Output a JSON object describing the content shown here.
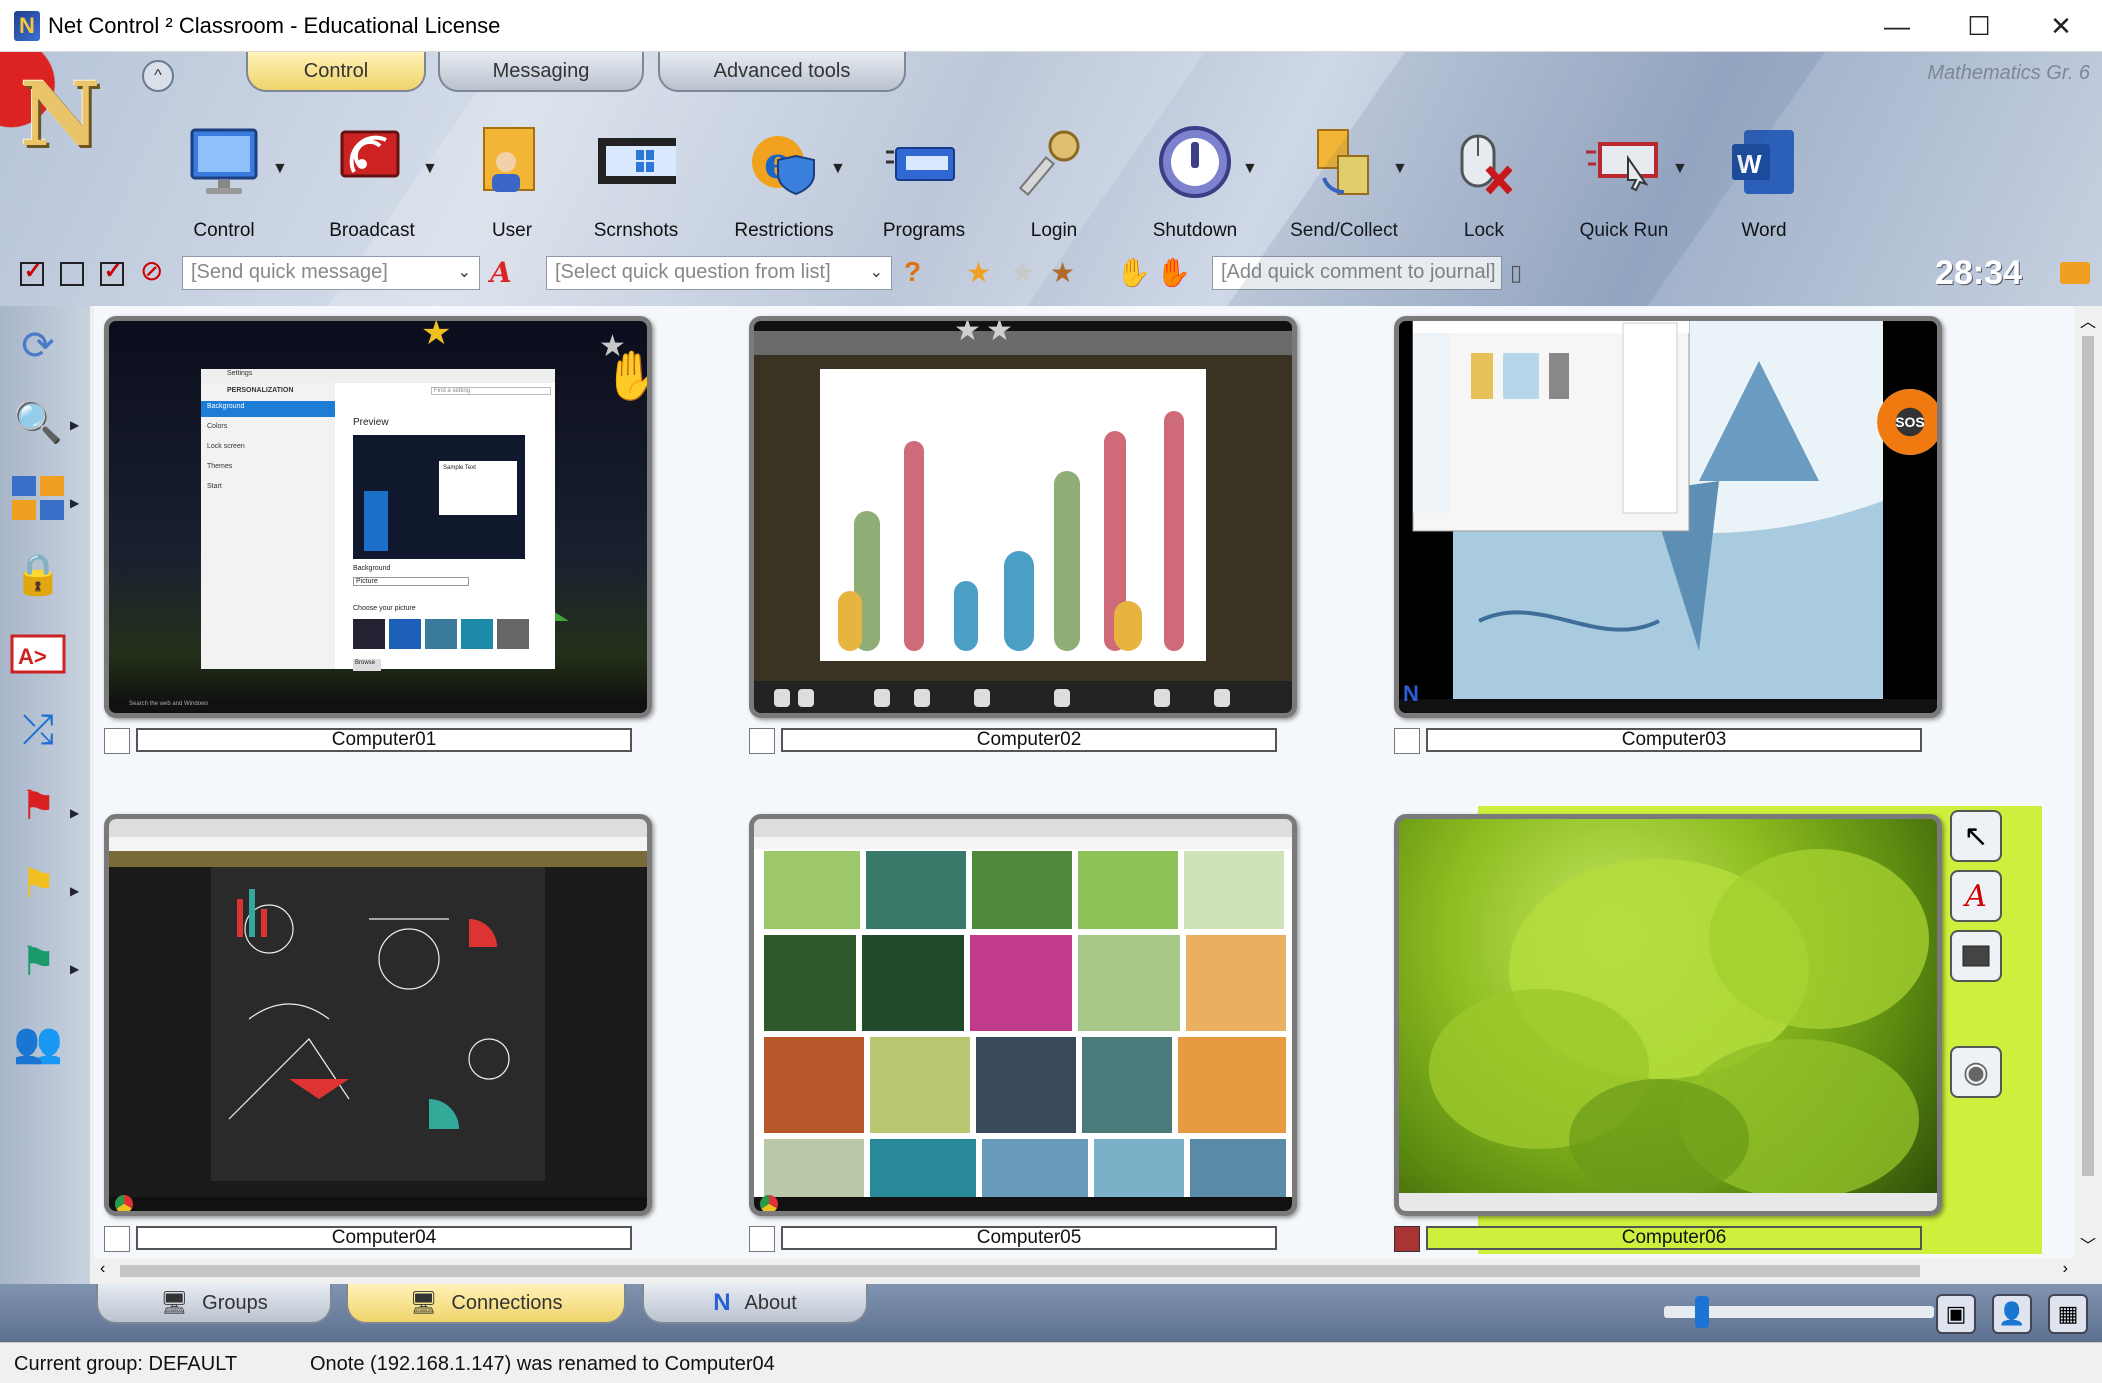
{
  "window": {
    "title": "Net Control ² Classroom - Educational License",
    "min": "—",
    "max": "☐",
    "close": "✕"
  },
  "ribbon": {
    "collapse": "^",
    "tabs": [
      "Control",
      "Messaging",
      "Advanced tools"
    ],
    "class_label": "Mathematics Gr. 6",
    "tools": [
      {
        "label": "Control",
        "icon": "monitor-icon"
      },
      {
        "label": "Broadcast",
        "icon": "broadcast-icon"
      },
      {
        "label": "User",
        "icon": "user-icon"
      },
      {
        "label": "Scrnshots",
        "icon": "film-icon"
      },
      {
        "label": "Restrictions",
        "icon": "shield-icon"
      },
      {
        "label": "Programs",
        "icon": "programs-icon"
      },
      {
        "label": "Login",
        "icon": "key-icon"
      },
      {
        "label": "Shutdown",
        "icon": "power-icon"
      },
      {
        "label": "Send/Collect",
        "icon": "files-icon"
      },
      {
        "label": "Lock",
        "icon": "mouse-lock-icon"
      },
      {
        "label": "Quick Run",
        "icon": "quick-run-icon"
      },
      {
        "label": "Word",
        "icon": "word-icon"
      }
    ],
    "quick_message_placeholder": "[Send quick message]",
    "quick_question_placeholder": "[Select quick question from list]",
    "journal_placeholder": "[Add quick comment to journal]",
    "clock": "28:34"
  },
  "computers": [
    {
      "name": "Computer01",
      "checked": false
    },
    {
      "name": "Computer02",
      "checked": false
    },
    {
      "name": "Computer03",
      "checked": false
    },
    {
      "name": "Computer04",
      "checked": false
    },
    {
      "name": "Computer05",
      "checked": false
    },
    {
      "name": "Computer06",
      "checked": true
    }
  ],
  "thumb_text": {
    "c01_settings": "Settings",
    "c01_personalization": "PERSONALIZATION",
    "c01_preview": "Preview",
    "c01_background": "Background",
    "c01_colors": "Colors",
    "c01_lockscreen": "Lock screen",
    "c01_themes": "Themes",
    "c01_start": "Start",
    "c01_picture": "Picture",
    "c01_choose": "Choose your picture",
    "c01_browse": "Browse",
    "c01_sample": "Sample Text",
    "c01_find": "Find a setting",
    "c01_taskbar_search": "Search the web and Windows",
    "c03_sos": "SOS"
  },
  "bottom": {
    "tabs": [
      "Groups",
      "Connections",
      "About"
    ],
    "zoom": 0.12
  },
  "status": {
    "group": "Current group: DEFAULT",
    "message": "Onote (192.168.1.147) was renamed to Computer04"
  },
  "colors": {
    "selected": "#cef03c",
    "active_tab": "#f0d36b",
    "accent": "#1d73d4"
  }
}
